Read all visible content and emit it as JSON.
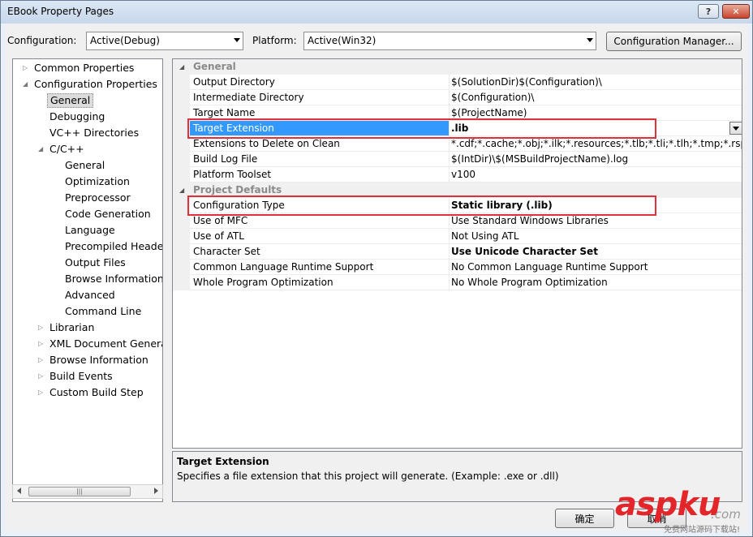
{
  "window": {
    "title": "EBook Property Pages"
  },
  "toolbar": {
    "configuration_label": "Configuration:",
    "configuration_value": "Active(Debug)",
    "platform_label": "Platform:",
    "platform_value": "Active(Win32)",
    "config_manager_label": "Configuration Manager..."
  },
  "tree": {
    "common_properties": "Common Properties",
    "configuration_properties": "Configuration Properties",
    "general": "General",
    "debugging": "Debugging",
    "vc_directories": "VC++ Directories",
    "c_cpp": "C/C++",
    "c_general": "General",
    "optimization": "Optimization",
    "preprocessor": "Preprocessor",
    "code_generation": "Code Generation",
    "language": "Language",
    "precompiled_headers": "Precompiled Header",
    "output_files": "Output Files",
    "browse_information": "Browse Information",
    "advanced": "Advanced",
    "command_line": "Command Line",
    "librarian": "Librarian",
    "xml_document": "XML Document Generat",
    "browse_information_top": "Browse Information",
    "build_events": "Build Events",
    "custom_build_step": "Custom Build Step",
    "scroll_thumb_glyph": "|||"
  },
  "grid": {
    "general_category": "General",
    "project_defaults_category": "Project Defaults",
    "rows": [
      {
        "name": "Output Directory",
        "value": "$(SolutionDir)$(Configuration)\\"
      },
      {
        "name": "Intermediate Directory",
        "value": "$(Configuration)\\"
      },
      {
        "name": "Target Name",
        "value": "$(ProjectName)"
      },
      {
        "name": "Target Extension",
        "value": ".lib"
      },
      {
        "name": "Extensions to Delete on Clean",
        "value": "*.cdf;*.cache;*.obj;*.ilk;*.resources;*.tlb;*.tli;*.tlh;*.tmp;*.rsp;*.pgc"
      },
      {
        "name": "Build Log File",
        "value": "$(IntDir)\\$(MSBuildProjectName).log"
      },
      {
        "name": "Platform Toolset",
        "value": "v100"
      },
      {
        "name": "Configuration Type",
        "value": "Static library (.lib)"
      },
      {
        "name": "Use of MFC",
        "value": "Use Standard Windows Libraries"
      },
      {
        "name": "Use of ATL",
        "value": "Not Using ATL"
      },
      {
        "name": "Character Set",
        "value": "Use Unicode Character Set"
      },
      {
        "name": "Common Language Runtime Support",
        "value": "No Common Language Runtime Support"
      },
      {
        "name": "Whole Program Optimization",
        "value": "No Whole Program Optimization"
      }
    ]
  },
  "description": {
    "title": "Target Extension",
    "text": "Specifies a file extension that this project will generate. (Example: .exe or .dll)"
  },
  "buttons": {
    "ok_label": "确定",
    "cancel_label": "取消"
  },
  "watermark": {
    "brand": "aspku",
    "suffix": ".com",
    "subtitle": "免费网站源码下载站!"
  },
  "colors": {
    "selection": "#3399ff",
    "highlight_box": "#e0303b"
  }
}
